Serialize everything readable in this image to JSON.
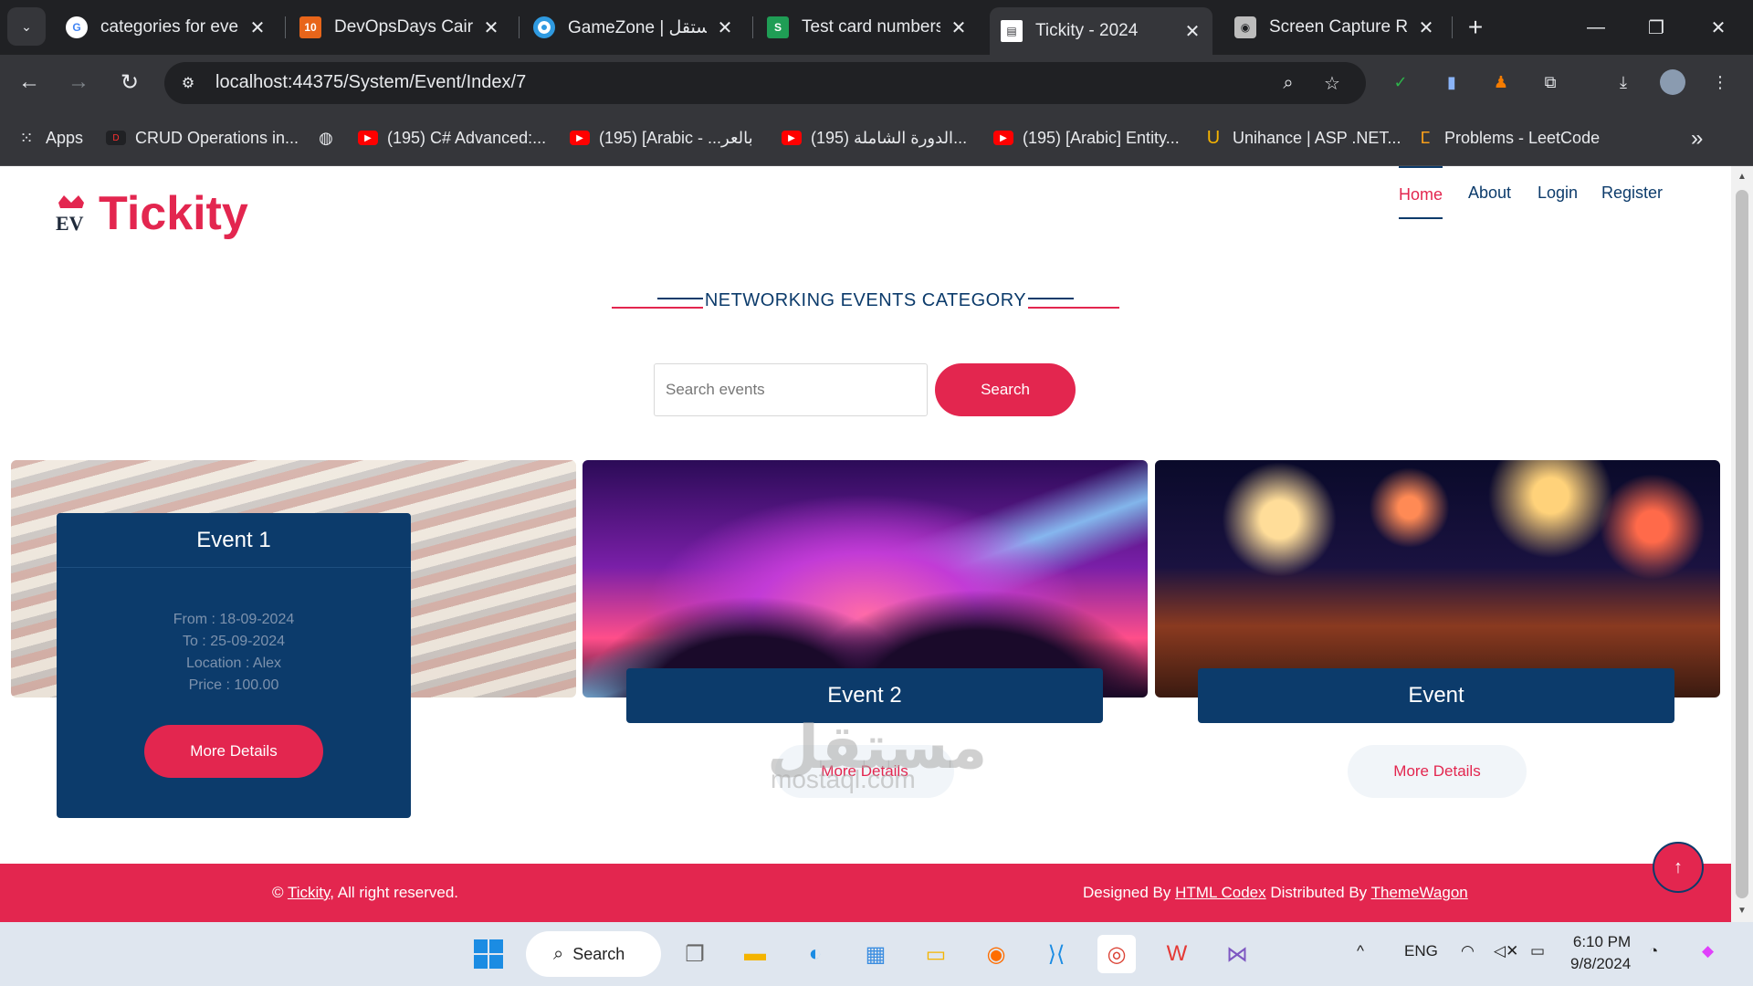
{
  "browser": {
    "tabs": [
      {
        "title": "categories for even",
        "favicon": "google-icon",
        "color": "#ffffff"
      },
      {
        "title": "DevOpsDays Cairo",
        "favicon": "devopsdays-icon",
        "color": "#e8651a"
      },
      {
        "title": "GameZone | مستقل",
        "favicon": "circle-icon",
        "color": "#2f9ae0"
      },
      {
        "title": "Test card numbers",
        "favicon": "stripe-icon",
        "color": "#1f9d55"
      },
      {
        "title": "Tickity - 2024",
        "favicon": "document-icon",
        "color": "#ffffff"
      },
      {
        "title": "Screen Capture Re",
        "favicon": "camera-icon",
        "color": "#bdbdbd"
      }
    ],
    "url": "localhost:44375/System/Event/Index/7",
    "bookmarks": [
      {
        "label": "Apps",
        "icon": "apps-grid-icon"
      },
      {
        "label": "CRUD Operations in...",
        "icon": "crud-icon"
      },
      {
        "label": "",
        "icon": "globe-icon"
      },
      {
        "label": "(195) C# Advanced:...",
        "icon": "youtube-icon"
      },
      {
        "label": "(195) [Arabic - ...بالعر",
        "icon": "youtube-icon"
      },
      {
        "label": "(195) الدورة الشاملة...",
        "icon": "youtube-icon"
      },
      {
        "label": "(195) [Arabic] Entity...",
        "icon": "youtube-icon"
      },
      {
        "label": "Unihance | ASP .NET...",
        "icon": "unihance-icon"
      },
      {
        "label": "Problems - LeetCode",
        "icon": "leetcode-icon"
      }
    ]
  },
  "site": {
    "brand": "Tickity",
    "nav": [
      {
        "label": "Home",
        "active": true
      },
      {
        "label": "About",
        "active": false
      },
      {
        "label": "Login",
        "active": false
      },
      {
        "label": "Register",
        "active": false
      }
    ],
    "section_title": "NETWORKING EVENTS CATEGORY",
    "search": {
      "placeholder": "Search events",
      "button": "Search"
    },
    "events": [
      {
        "title": "Event 1",
        "from": "From : 18-09-2024",
        "to": "To : 25-09-2024",
        "location": "Location : Alex",
        "price": "Price : 100.00",
        "button": "More Details"
      },
      {
        "title": "Event 2",
        "button": "More Details"
      },
      {
        "title": "Event",
        "button": "More Details"
      }
    ],
    "footer": {
      "brand_link": "Tickity",
      "rights": ", All right reserved.",
      "designed_by": "Designed By ",
      "designer": "HTML Codex",
      "distributed_by": " Distributed By ",
      "distributor": "ThemeWagon"
    },
    "watermark": "مستقل",
    "watermark_sub": "mostaql.com",
    "colors": {
      "primary": "#e3264f",
      "navy": "#0c3b6b"
    }
  },
  "taskbar": {
    "search_label": "Search",
    "language": "ENG",
    "time": "6:10 PM",
    "date": "9/8/2024"
  }
}
